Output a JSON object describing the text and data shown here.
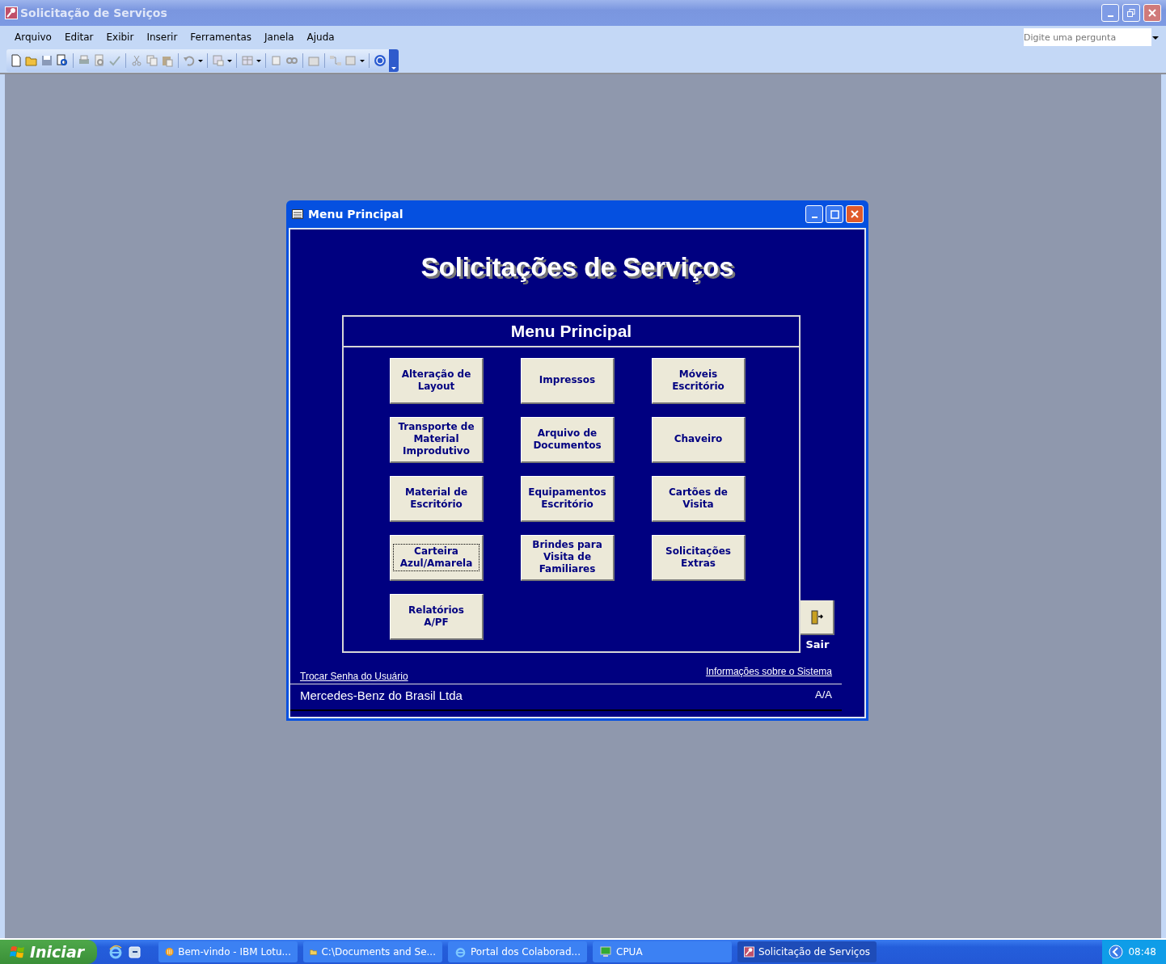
{
  "window": {
    "title": "Solicitação de Serviços"
  },
  "menu": [
    "Arquivo",
    "Editar",
    "Exibir",
    "Inserir",
    "Ferramentas",
    "Janela",
    "Ajuda"
  ],
  "help_search": {
    "placeholder": "Digite uma pergunta"
  },
  "form": {
    "title": "Menu Principal",
    "heading": "Solicitações de Serviços",
    "panel_title": "Menu Principal",
    "buttons": [
      {
        "label": "Alteração de Layout",
        "focused": false
      },
      {
        "label": "Impressos",
        "focused": false
      },
      {
        "label": "Móveis Escritório",
        "focused": false
      },
      {
        "label": "Transporte de Material Improdutivo",
        "focused": false
      },
      {
        "label": "Arquivo de Documentos",
        "focused": false
      },
      {
        "label": "Chaveiro",
        "focused": false
      },
      {
        "label": "Material de Escritório",
        "focused": false
      },
      {
        "label": "Equipamentos Escritório",
        "focused": false
      },
      {
        "label": "Cartões de Visita",
        "focused": false
      },
      {
        "label": "Carteira Azul/Amarela",
        "focused": true
      },
      {
        "label": "Brindes para Visita de Familiares",
        "focused": false
      },
      {
        "label": "Solicitações Extras",
        "focused": false
      },
      {
        "label": "Relatórios A/PF",
        "focused": false
      }
    ],
    "exit_label": "Sair",
    "link_left": "Trocar Senha do Usuário",
    "link_right": "Informações sobre o Sistema",
    "company": "Mercedes-Benz do Brasil Ltda",
    "code": "A/A"
  },
  "taskbar": {
    "start": "Iniciar",
    "items": [
      {
        "label": "Bem-vindo - IBM Lotu...",
        "selected": false
      },
      {
        "label": "C:\\Documents and Se...",
        "selected": false
      },
      {
        "label": "Portal dos Colaborad...",
        "selected": false
      },
      {
        "label": "CPUA",
        "selected": false
      },
      {
        "label": "Solicitação de Serviços",
        "selected": true
      }
    ],
    "clock": "08:48"
  }
}
